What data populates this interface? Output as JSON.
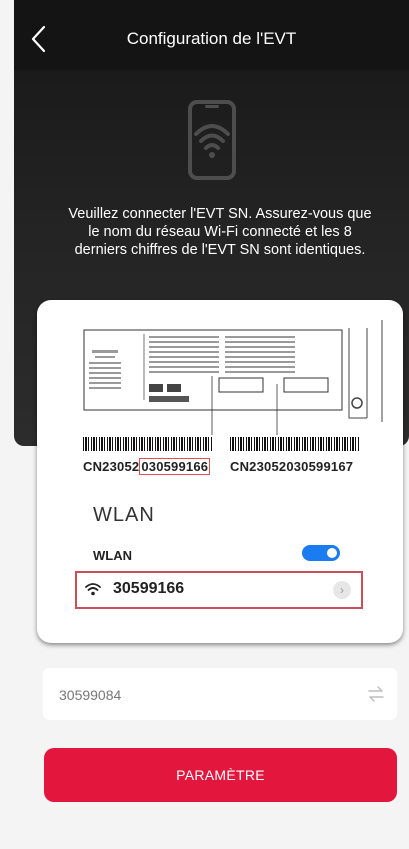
{
  "header": {
    "title": "Configuration de l'EVT",
    "back_icon": "chevron-left-icon"
  },
  "hero": {
    "icon": "phone-wifi-icon",
    "instructions": "Veuillez connecter l'EVT SN. Assurez-vous que le nom du réseau Wi-Fi connecté et les 8 derniers chiffres de l'EVT SN sont identiques."
  },
  "illustration": {
    "serial_1_prefix": "CN23052",
    "serial_1_highlight": "030599166",
    "serial_2": "CN23052030599167",
    "wlan_heading": "WLAN",
    "wlan_label": "WLAN",
    "wlan_enabled": true,
    "network_name": "30599166",
    "wifi_icon": "wifi-icon",
    "chevron_icon": "chevron-right-icon",
    "highlight_color": "#c8505a"
  },
  "form": {
    "sn_value": "30599084",
    "swap_icon": "swap-arrows-icon"
  },
  "actions": {
    "submit_label": "PARAMÈTRE",
    "submit_color": "#e3173e"
  }
}
